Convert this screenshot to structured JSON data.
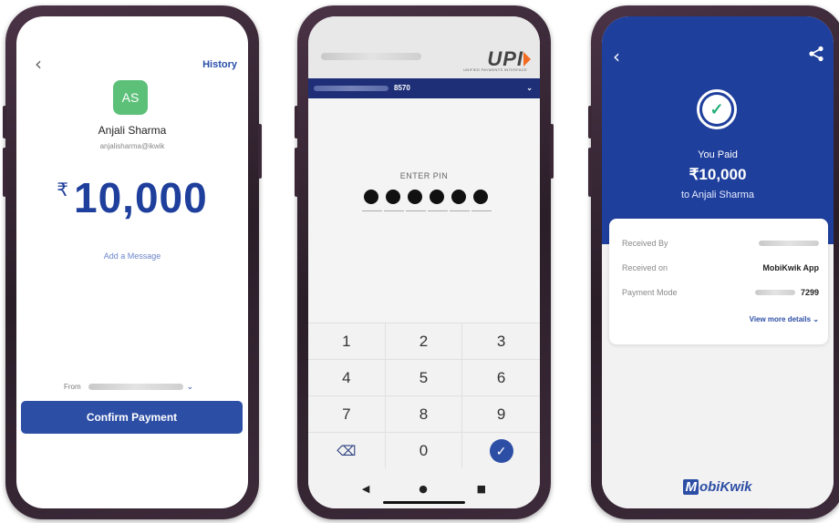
{
  "screen1": {
    "back_icon": "chevron-left-icon",
    "history_label": "History",
    "avatar_initials": "AS",
    "avatar_color": "#5cc079",
    "payee_name": "Anjali Sharma",
    "payee_upi": "anjalisharma@ikwik",
    "currency_symbol": "₹",
    "amount": "10,000",
    "add_message_label": "Add a Message",
    "from_label": "From",
    "confirm_label": "Confirm Payment",
    "accent": "#2c4ea5"
  },
  "screen2": {
    "upi_logo": "UPI",
    "upi_tagline": "UNIFIED PAYMENTS INTERFACE",
    "account_suffix": "8570",
    "enter_pin_label": "ENTER PIN",
    "pin_filled_count": 6,
    "keys": [
      "1",
      "2",
      "3",
      "4",
      "5",
      "6",
      "7",
      "8",
      "9",
      "backspace-icon",
      "0",
      "submit-check-icon"
    ],
    "nav_icons": [
      "back-triangle-icon",
      "home-circle-icon",
      "recents-square-icon"
    ]
  },
  "screen3": {
    "back_icon": "chevron-left-icon",
    "share_icon": "share-icon",
    "status_icon": "check-circle-icon",
    "you_paid_label": "You Paid",
    "amount": "₹10,000",
    "to_label": "to Anjali Sharma",
    "rows": [
      {
        "label": "Received By",
        "value": ""
      },
      {
        "label": "Received on",
        "value": "MobiKwik App"
      },
      {
        "label": "Payment Mode",
        "value": "7299"
      }
    ],
    "view_more_label": "View more details",
    "brand_logo": "MobiKwik",
    "header_color": "#1f3f9c"
  }
}
